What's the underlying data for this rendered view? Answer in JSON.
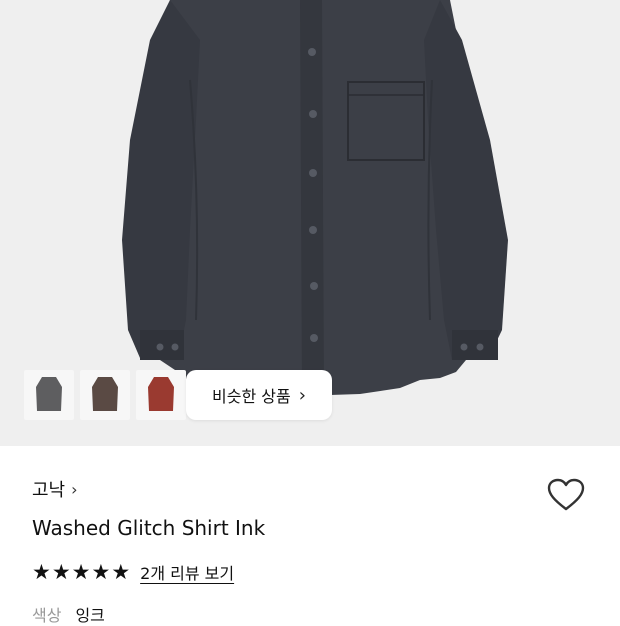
{
  "product": {
    "brand": "고낙",
    "title": "Washed Glitch Shirt Ink",
    "rating_stars": 5,
    "review_link": "2개 리뷰 보기",
    "option_label": "색상",
    "option_value": "잉크"
  },
  "gallery": {
    "similar_button": "비슷한 상품",
    "thumbnails": [
      {
        "name": "gray-shirt",
        "color": "#5e5e60"
      },
      {
        "name": "brown-shirt",
        "color": "#5a4a44"
      },
      {
        "name": "red-shirt",
        "color": "#9a3a30"
      }
    ]
  },
  "colors": {
    "shirt": "#3c3f47",
    "background": "#efefef",
    "star": "#111111"
  },
  "icons": {
    "brand_chevron": "chevron-right-icon",
    "similar_chevron": "chevron-right-icon",
    "wishlist": "heart-outline-icon",
    "star": "star-icon"
  }
}
